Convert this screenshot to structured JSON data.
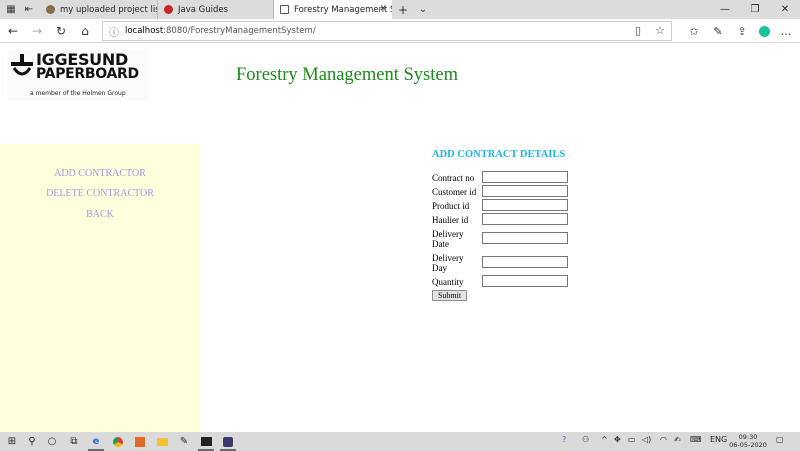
{
  "browser": {
    "tabs": [
      {
        "title": "my uploaded project list.do",
        "favicon_color": "#8b6b4a"
      },
      {
        "title": "Java Guides",
        "favicon_color": "#c62828"
      },
      {
        "title": "Forestry Management S",
        "favicon_color": "#555555"
      }
    ],
    "address": {
      "host": "localhost",
      "path": ":8080/ForestryManagementSystem/"
    }
  },
  "logo": {
    "line1": "IGGESUND",
    "line2": "PAPERBOARD",
    "tagline": "a member of the Holmen Group"
  },
  "header": {
    "title": "Forestry Management System",
    "title_color": "#1a8a1a"
  },
  "sidebar": {
    "background": "#ffffdd",
    "links": [
      {
        "label": "ADD CONTRACTOR"
      },
      {
        "label": "DELETE CONTRACTOR"
      },
      {
        "label": "BACK"
      }
    ]
  },
  "form": {
    "title": "ADD CONTRACT DETAILS",
    "title_color": "#1bb8e6",
    "fields": [
      {
        "label": "Contract no",
        "value": ""
      },
      {
        "label": "Customer id",
        "value": ""
      },
      {
        "label": "Product id",
        "value": ""
      },
      {
        "label": "Haulier id",
        "value": ""
      },
      {
        "label": "Delivery Date",
        "value": ""
      },
      {
        "label": "Delivery Day",
        "value": ""
      },
      {
        "label": "Quantity",
        "value": ""
      }
    ],
    "submit_label": "Submit"
  },
  "taskbar": {
    "language": "ENG",
    "time": "09:30",
    "date": "06-05-2020"
  }
}
